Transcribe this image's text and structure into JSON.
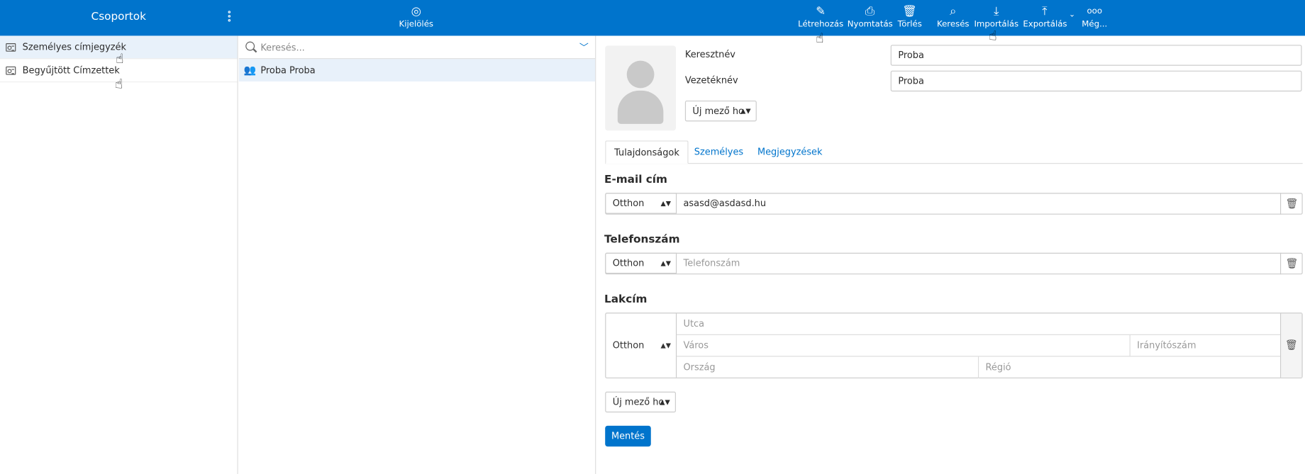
{
  "topbar": {
    "title": "Csoportok",
    "select_label": "Kijelölés",
    "create_label": "Létrehozás",
    "print_label": "Nyomtatás",
    "delete_label": "Törlés",
    "search_label": "Keresés",
    "import_label": "Importálás",
    "export_label": "Exportálás",
    "more_label": "Még..."
  },
  "groups": [
    {
      "label": "Személyes címjegyzék"
    },
    {
      "label": "Begyűjtött Címzettek"
    }
  ],
  "contacts": {
    "search_placeholder": "Keresés...",
    "items": [
      {
        "name": "Proba Proba"
      }
    ]
  },
  "contact": {
    "firstname_label": "Keresztnév",
    "firstname_value": "Proba",
    "lastname_label": "Vezetéknév",
    "lastname_value": "Proba",
    "add_field_label": "Új mező ho",
    "tabs": [
      "Tulajdonságok",
      "Személyes",
      "Megjegyzések"
    ],
    "email_heading": "E-mail cím",
    "email_type": "Otthon",
    "email_value": "asasd@asdasd.hu",
    "phone_heading": "Telefonszám",
    "phone_type": "Otthon",
    "phone_placeholder": "Telefonszám",
    "address_heading": "Lakcím",
    "address_type": "Otthon",
    "street_placeholder": "Utca",
    "city_placeholder": "Város",
    "zip_placeholder": "Irányítószám",
    "country_placeholder": "Ország",
    "region_placeholder": "Régió",
    "add_field_bottom_label": "Új mező ho",
    "save_label": "Mentés"
  },
  "colors": {
    "accent": "#0074cc",
    "selected_row": "#e8f1fa"
  }
}
